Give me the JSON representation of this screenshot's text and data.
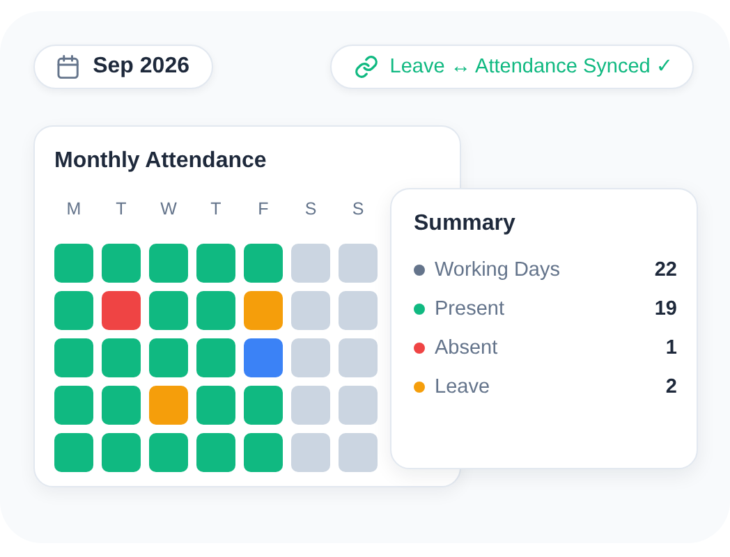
{
  "month": "Sep 2026",
  "sync_status": "Leave ↔ Attendance Synced ✓",
  "calendar": {
    "title": "Monthly Attendance",
    "weekdays": [
      "M",
      "T",
      "W",
      "T",
      "F",
      "S",
      "S"
    ],
    "weeks": [
      {
        "days": [
          {
            "color": "#10b981"
          },
          {
            "color": "#10b981"
          },
          {
            "color": "#10b981"
          },
          {
            "color": "#10b981"
          },
          {
            "color": "#10b981"
          },
          {
            "color": "#cbd5e1"
          },
          {
            "color": "#cbd5e1"
          }
        ]
      },
      {
        "days": [
          {
            "color": "#10b981"
          },
          {
            "color": "#ef4444"
          },
          {
            "color": "#10b981"
          },
          {
            "color": "#10b981"
          },
          {
            "color": "#f59e0b"
          },
          {
            "color": "#cbd5e1"
          },
          {
            "color": "#cbd5e1"
          }
        ]
      },
      {
        "days": [
          {
            "color": "#10b981"
          },
          {
            "color": "#10b981"
          },
          {
            "color": "#10b981"
          },
          {
            "color": "#10b981"
          },
          {
            "color": "#3b82f6"
          },
          {
            "color": "#cbd5e1"
          },
          {
            "color": "#cbd5e1"
          }
        ]
      },
      {
        "days": [
          {
            "color": "#10b981"
          },
          {
            "color": "#10b981"
          },
          {
            "color": "#f59e0b"
          },
          {
            "color": "#10b981"
          },
          {
            "color": "#10b981"
          },
          {
            "color": "#cbd5e1"
          },
          {
            "color": "#cbd5e1"
          }
        ]
      },
      {
        "days": [
          {
            "color": "#10b981"
          },
          {
            "color": "#10b981"
          },
          {
            "color": "#10b981"
          },
          {
            "color": "#10b981"
          },
          {
            "color": "#10b981"
          },
          {
            "color": "#cbd5e1"
          },
          {
            "color": "#cbd5e1"
          }
        ]
      }
    ]
  },
  "summary": {
    "title": "Summary",
    "items": [
      {
        "label": "Working Days",
        "value": "22",
        "color": "#64748b"
      },
      {
        "label": "Present",
        "value": "19",
        "color": "#10b981"
      },
      {
        "label": "Absent",
        "value": "1",
        "color": "#ef4444"
      },
      {
        "label": "Leave",
        "value": "2",
        "color": "#f59e0b"
      }
    ]
  }
}
